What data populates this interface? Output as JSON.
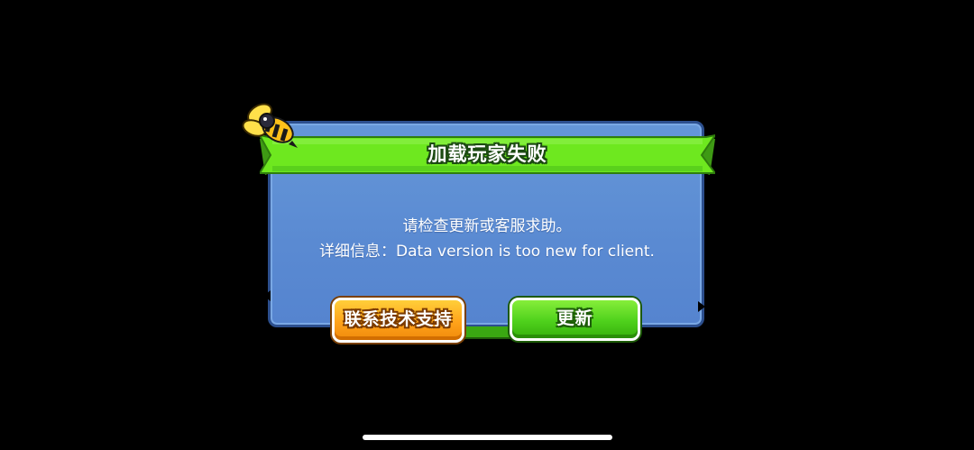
{
  "dialog": {
    "title": "加载玩家失败",
    "message_line1": "请检查更新或客服求助。",
    "message_line2": "详细信息：Data version is too new for client."
  },
  "buttons": {
    "support_label": "联系技术支持",
    "update_label": "更新"
  },
  "colors": {
    "background": "#000000",
    "panel_blue": "#5a8ad2",
    "ribbon_green": "#6ee81f",
    "support_orange": "#ffa31a",
    "update_green": "#4fd11c"
  },
  "icons": {
    "mascot": "bee-icon"
  }
}
